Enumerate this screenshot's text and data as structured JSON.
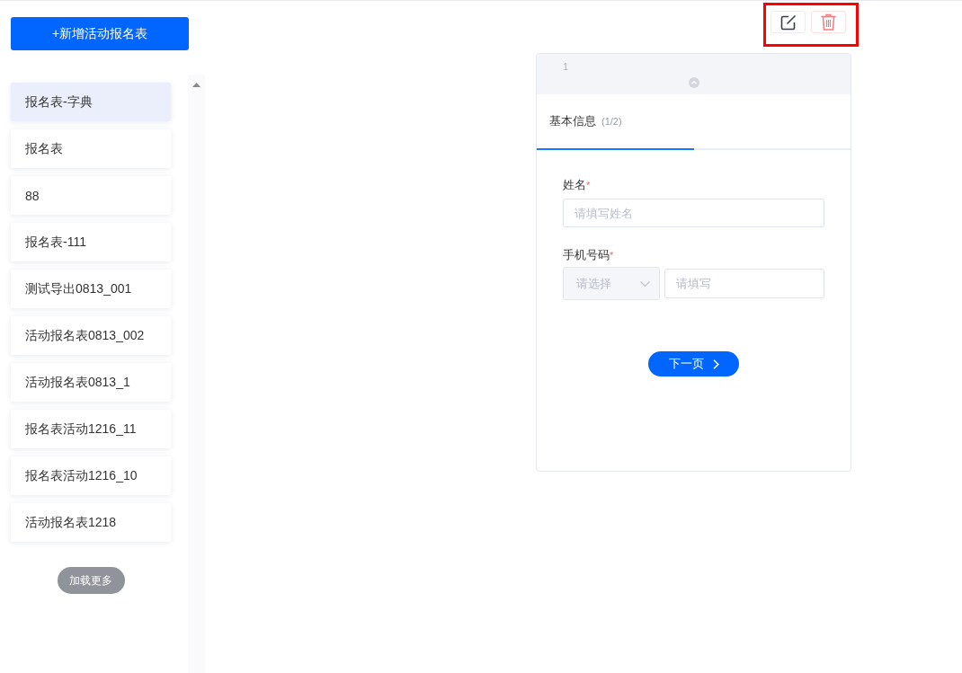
{
  "sidebar": {
    "add_button": "+新增活动报名表",
    "items": [
      {
        "label": "报名表-字典",
        "selected": true
      },
      {
        "label": "报名表",
        "selected": false
      },
      {
        "label": "88",
        "selected": false
      },
      {
        "label": "报名表-111",
        "selected": false
      },
      {
        "label": "测试导出0813_001",
        "selected": false
      },
      {
        "label": "活动报名表0813_002",
        "selected": false
      },
      {
        "label": "活动报名表0813_1",
        "selected": false
      },
      {
        "label": "报名表活动1216_11",
        "selected": false
      },
      {
        "label": "报名表活动1216_10",
        "selected": false
      },
      {
        "label": "活动报名表1218",
        "selected": false
      }
    ],
    "load_more": "加载更多"
  },
  "toolbar": {
    "highlighted": true
  },
  "preview": {
    "page_number": "1",
    "step": {
      "title": "基本信息",
      "count": "(1/2)",
      "level": 0.5
    },
    "fields": [
      {
        "kind": "text",
        "label": "姓名",
        "required_mark": "*",
        "placeholder": "请填写姓名"
      },
      {
        "kind": "phone",
        "label": "手机号码",
        "required_mark": "*",
        "select_placeholder": "请选择",
        "placeholder": "请填写"
      }
    ],
    "next_button": "下一页"
  }
}
